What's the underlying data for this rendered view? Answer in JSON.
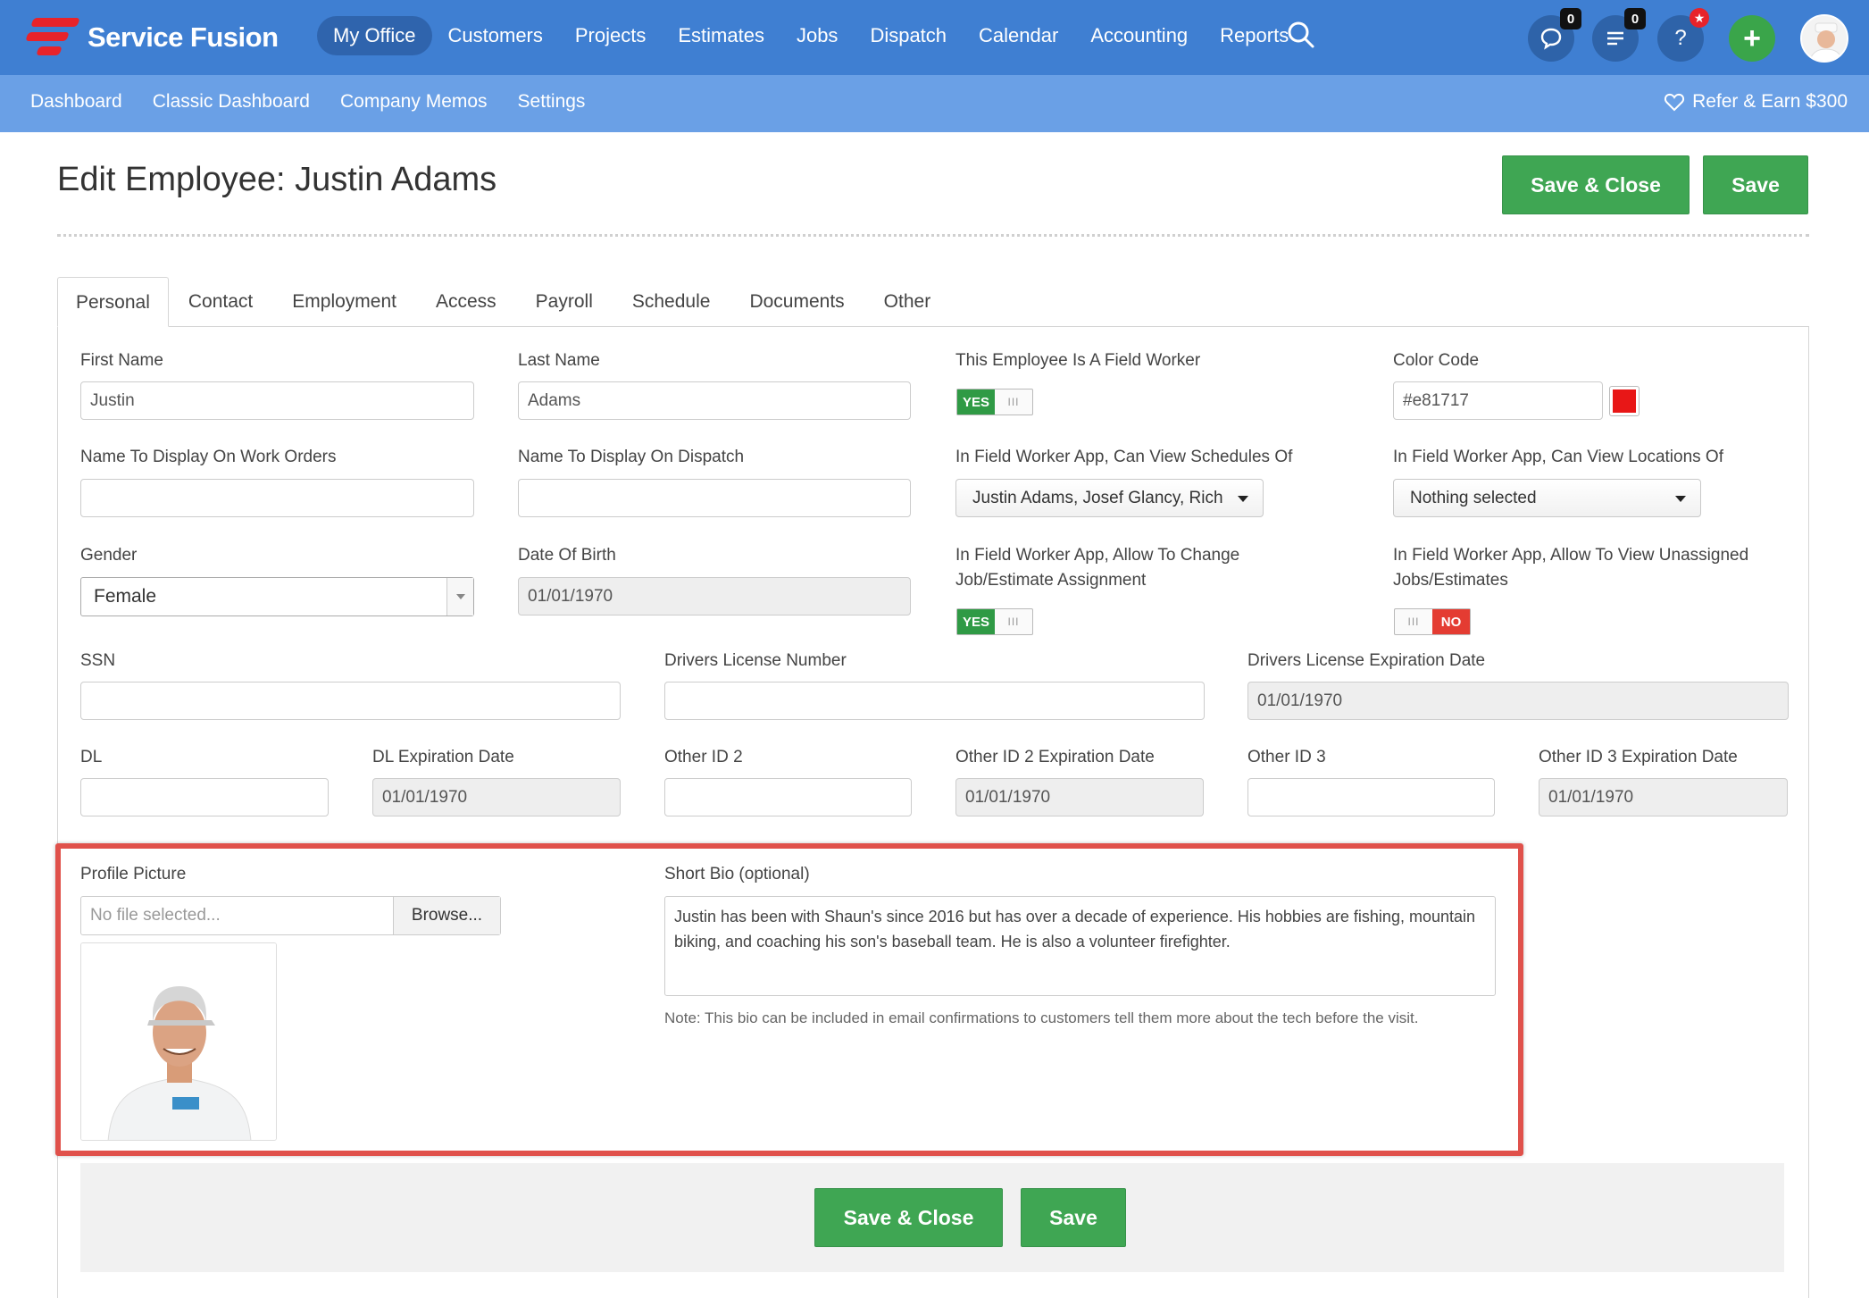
{
  "app": {
    "brand": "Service Fusion",
    "brand_color": "#e8232a"
  },
  "mainnav": {
    "items": [
      "My Office",
      "Customers",
      "Projects",
      "Estimates",
      "Jobs",
      "Dispatch",
      "Calendar",
      "Accounting",
      "Reports"
    ],
    "active": "My Office"
  },
  "topicons": {
    "chat_count": "0",
    "tasks_count": "0",
    "help_label": "?",
    "add_label": "+"
  },
  "subnav": {
    "items": [
      "Dashboard",
      "Classic Dashboard",
      "Company Memos",
      "Settings"
    ],
    "refer_label": "Refer & Earn $300"
  },
  "page": {
    "title": "Edit Employee: Justin Adams",
    "save_close_label": "Save & Close",
    "save_label": "Save"
  },
  "tabs": {
    "items": [
      "Personal",
      "Contact",
      "Employment",
      "Access",
      "Payroll",
      "Schedule",
      "Documents",
      "Other"
    ],
    "active": "Personal"
  },
  "form": {
    "first_name": {
      "label": "First Name",
      "value": "Justin"
    },
    "last_name": {
      "label": "Last Name",
      "value": "Adams"
    },
    "field_worker": {
      "label": "This Employee Is A Field Worker",
      "on_label": "YES",
      "grip": "III"
    },
    "color_code": {
      "label": "Color Code",
      "value": "#e81717",
      "swatch": "#e81717"
    },
    "name_work_orders": {
      "label": "Name To Display On Work Orders",
      "value": ""
    },
    "name_dispatch": {
      "label": "Name To Display On Dispatch",
      "value": ""
    },
    "view_schedules": {
      "label": "In Field Worker App, Can View Schedules Of",
      "value": "Justin Adams, Josef Glancy, Rich"
    },
    "view_locations": {
      "label": "In Field Worker App, Can View Locations Of",
      "value": "Nothing selected"
    },
    "gender": {
      "label": "Gender",
      "value": "Female"
    },
    "dob": {
      "label": "Date Of Birth",
      "value": "01/01/1970"
    },
    "change_assignment": {
      "label_line1": "In Field Worker App, Allow To Change",
      "label_line2": "Job/Estimate Assignment",
      "on_label": "YES",
      "grip": "III"
    },
    "view_unassigned": {
      "label_line1": "In Field Worker App, Allow To View Unassigned",
      "label_line2": "Jobs/Estimates",
      "off_label": "NO",
      "grip": "III"
    },
    "ssn": {
      "label": "SSN",
      "value": ""
    },
    "dl_number": {
      "label": "Drivers License Number",
      "value": ""
    },
    "dl_expiration": {
      "label": "Drivers License Expiration Date",
      "value": "01/01/1970"
    },
    "dl": {
      "label": "DL",
      "value": ""
    },
    "dl_exp_date": {
      "label": "DL Expiration Date",
      "value": "01/01/1970"
    },
    "other_id2": {
      "label": "Other ID 2",
      "value": ""
    },
    "other_id2_exp": {
      "label": "Other ID 2 Expiration Date",
      "value": "01/01/1970"
    },
    "other_id3": {
      "label": "Other ID 3",
      "value": ""
    },
    "other_id3_exp": {
      "label": "Other ID 3 Expiration Date",
      "value": "01/01/1970"
    },
    "profile_picture": {
      "label": "Profile Picture",
      "placeholder": "No file selected...",
      "browse_label": "Browse..."
    },
    "short_bio": {
      "label": "Short Bio (optional)",
      "value": "Justin has been with Shaun's since 2016 but has over a decade of experience. His hobbies are fishing, mountain biking, and coaching his son's baseball team. He is also a volunteer firefighter.",
      "note": "Note: This bio can be included in email confirmations to customers tell them more about the tech before the visit."
    }
  },
  "footer": {
    "save_close_label": "Save & Close",
    "save_label": "Save"
  },
  "colors": {
    "nav_blue": "#3f7fd2",
    "subnav_blue": "#6aa0e6",
    "button_green": "#3fa653",
    "highlight_red": "#e0514b"
  }
}
